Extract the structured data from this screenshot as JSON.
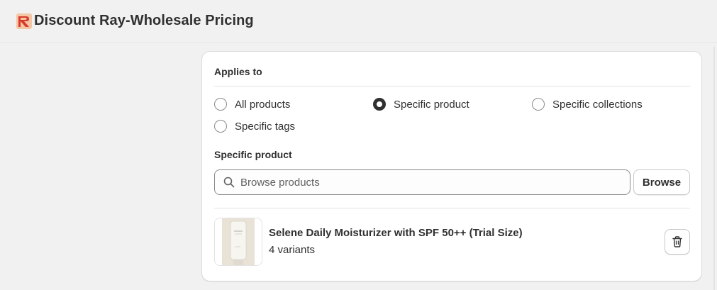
{
  "app": {
    "title": "Discount Ray-Wholesale Pricing",
    "logo_icon": "app-logo-icon"
  },
  "applies_to": {
    "title": "Applies to",
    "options": [
      {
        "label": "All products",
        "checked": false
      },
      {
        "label": "Specific product",
        "checked": true
      },
      {
        "label": "Specific collections",
        "checked": false
      },
      {
        "label": "Specific tags",
        "checked": false
      }
    ]
  },
  "specific_product": {
    "title": "Specific product",
    "search_placeholder": "Browse products",
    "search_value": "",
    "browse_label": "Browse"
  },
  "products": [
    {
      "name": "Selene Daily Moisturizer with SPF 50++ (Trial Size)",
      "variants": "4 variants"
    }
  ],
  "colors": {
    "accent": "#303030",
    "background": "#f1f1f1",
    "logo_red": "#d93b2b"
  }
}
